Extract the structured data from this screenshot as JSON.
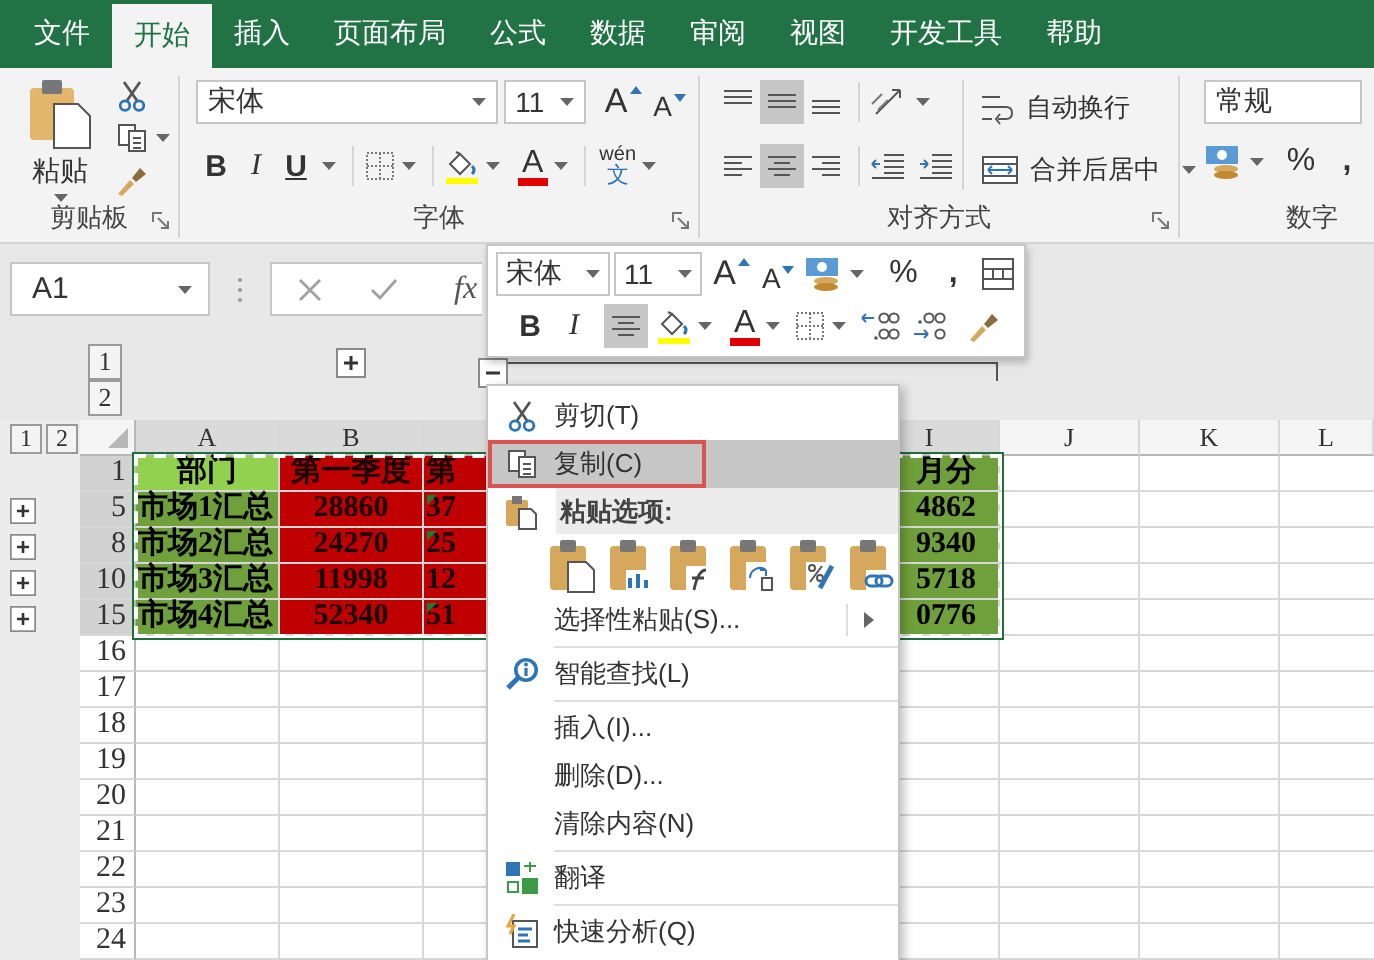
{
  "ribbon": {
    "tabs": [
      {
        "label": "文件",
        "selected": false
      },
      {
        "label": "开始",
        "selected": true
      },
      {
        "label": "插入",
        "selected": false
      },
      {
        "label": "页面布局",
        "selected": false
      },
      {
        "label": "公式",
        "selected": false
      },
      {
        "label": "数据",
        "selected": false
      },
      {
        "label": "审阅",
        "selected": false
      },
      {
        "label": "视图",
        "selected": false
      },
      {
        "label": "开发工具",
        "selected": false
      },
      {
        "label": "帮助",
        "selected": false
      }
    ],
    "clipboard": {
      "title": "剪贴板",
      "paste_label": "粘贴"
    },
    "font": {
      "title": "字体",
      "font_name": "宋体",
      "font_size": "11",
      "grow_label": "A",
      "shrink_label": "A",
      "bold_label": "B",
      "italic_label": "I",
      "underline_label": "U",
      "font_color_label": "A",
      "phonetic_top": "wén",
      "phonetic_bottom": "文"
    },
    "alignment": {
      "title": "对齐方式",
      "vertical": [
        {
          "kind": "top",
          "selected": false
        },
        {
          "kind": "middle",
          "selected": true
        },
        {
          "kind": "bottom",
          "selected": false
        }
      ],
      "horizontal": [
        {
          "kind": "left",
          "selected": false
        },
        {
          "kind": "center",
          "selected": true
        },
        {
          "kind": "right",
          "selected": false
        }
      ],
      "wrap_text_label": "自动换行",
      "merge_label": "合并后居中"
    },
    "number": {
      "title": "数字",
      "format": "常规",
      "percent_label": "%",
      "comma_label": ","
    }
  },
  "formula_bar": {
    "name_box": "A1",
    "function_label": "fx"
  },
  "outline": {
    "column_levels": [
      "1",
      "2"
    ],
    "column_groups": [
      {
        "expanded": false
      },
      {
        "expanded": true
      }
    ],
    "row_levels": [
      "1",
      "2"
    ]
  },
  "sheet": {
    "columns": [
      {
        "label": "A",
        "selected": true
      },
      {
        "label": "B",
        "selected": true
      },
      {
        "selected": true
      },
      {
        "label": "I",
        "selected": true
      },
      {
        "label": "J",
        "selected": false
      },
      {
        "label": "K",
        "selected": false
      },
      {
        "label": "L",
        "selected": false
      }
    ],
    "rows": [
      {
        "header": "1",
        "selected": true,
        "collapsed_group": false,
        "cells": [
          {
            "text": "部门",
            "color": "#92d050",
            "error_flag": false
          },
          {
            "text": "第一季度",
            "color": "#c00000",
            "error_flag": false
          },
          {
            "text": "第",
            "color": "#c00000",
            "error_flag": false
          },
          {
            "text": "月分",
            "color": "#70a03c",
            "error_flag": false
          }
        ]
      },
      {
        "header": "5",
        "selected": true,
        "collapsed_group": true,
        "cells": [
          {
            "text": "市场1汇总",
            "color": "#70a03c",
            "error_flag": false
          },
          {
            "text": "28860",
            "color": "#c00000",
            "error_flag": false
          },
          {
            "text": "37",
            "color": "#c00000",
            "error_flag": true
          },
          {
            "text": "4862",
            "color": "#70a03c",
            "error_flag": false
          }
        ]
      },
      {
        "header": "8",
        "selected": true,
        "collapsed_group": true,
        "cells": [
          {
            "text": "市场2汇总",
            "color": "#70a03c",
            "error_flag": false
          },
          {
            "text": "24270",
            "color": "#c00000",
            "error_flag": false
          },
          {
            "text": "25",
            "color": "#c00000",
            "error_flag": true
          },
          {
            "text": "9340",
            "color": "#70a03c",
            "error_flag": false
          }
        ]
      },
      {
        "header": "10",
        "selected": true,
        "collapsed_group": true,
        "cells": [
          {
            "text": "市场3汇总",
            "color": "#70a03c",
            "error_flag": false
          },
          {
            "text": "11998",
            "color": "#c00000",
            "error_flag": false
          },
          {
            "text": "12",
            "color": "#c00000",
            "error_flag": false
          },
          {
            "text": "5718",
            "color": "#70a03c",
            "error_flag": false
          }
        ]
      },
      {
        "header": "15",
        "selected": true,
        "collapsed_group": true,
        "cells": [
          {
            "text": "市场4汇总",
            "color": "#70a03c",
            "error_flag": false
          },
          {
            "text": "52340",
            "color": "#c00000",
            "error_flag": false
          },
          {
            "text": "51",
            "color": "#c00000",
            "error_flag": true
          },
          {
            "text": "0776",
            "color": "#70a03c",
            "error_flag": false
          }
        ]
      },
      {
        "header": "16",
        "selected": false,
        "collapsed_group": false
      },
      {
        "header": "17",
        "selected": false,
        "collapsed_group": false
      },
      {
        "header": "18",
        "selected": false,
        "collapsed_group": false
      },
      {
        "header": "19",
        "selected": false,
        "collapsed_group": false
      },
      {
        "header": "20",
        "selected": false,
        "collapsed_group": false
      },
      {
        "header": "21",
        "selected": false,
        "collapsed_group": false
      },
      {
        "header": "22",
        "selected": false,
        "collapsed_group": false
      },
      {
        "header": "23",
        "selected": false,
        "collapsed_group": false
      },
      {
        "header": "24",
        "selected": false,
        "collapsed_group": false
      }
    ]
  },
  "mini_toolbar": {
    "font_name": "宋体",
    "font_size": "11",
    "grow_label": "A",
    "shrink_label": "A",
    "percent_label": "%",
    "comma_label": ",",
    "bold_label": "B",
    "italic_label": "I",
    "font_color_label": "A",
    "center_selected": true
  },
  "context_menu": {
    "items": [
      {
        "kind": "item",
        "label": "剪切(T)",
        "selected": false,
        "annotated": false,
        "submenu": false
      },
      {
        "kind": "item",
        "label": "复制(C)",
        "selected": true,
        "annotated": true,
        "submenu": false
      },
      {
        "kind": "header",
        "label": "粘贴选项:"
      },
      {
        "kind": "paste_options"
      },
      {
        "kind": "item",
        "label": "选择性粘贴(S)...",
        "selected": false,
        "annotated": false,
        "submenu": true
      },
      {
        "kind": "separator"
      },
      {
        "kind": "item",
        "label": "智能查找(L)",
        "selected": false,
        "annotated": false,
        "submenu": false
      },
      {
        "kind": "separator"
      },
      {
        "kind": "item",
        "label": "插入(I)...",
        "selected": false,
        "annotated": false,
        "submenu": false
      },
      {
        "kind": "item",
        "label": "删除(D)...",
        "selected": false,
        "annotated": false,
        "submenu": false
      },
      {
        "kind": "item",
        "label": "清除内容(N)",
        "selected": false,
        "annotated": false,
        "submenu": false
      },
      {
        "kind": "separator"
      },
      {
        "kind": "item",
        "label": "翻译",
        "selected": false,
        "annotated": false,
        "submenu": false
      },
      {
        "kind": "separator"
      },
      {
        "kind": "item",
        "label": "快速分析(Q)",
        "selected": false,
        "annotated": false,
        "submenu": false
      }
    ]
  }
}
